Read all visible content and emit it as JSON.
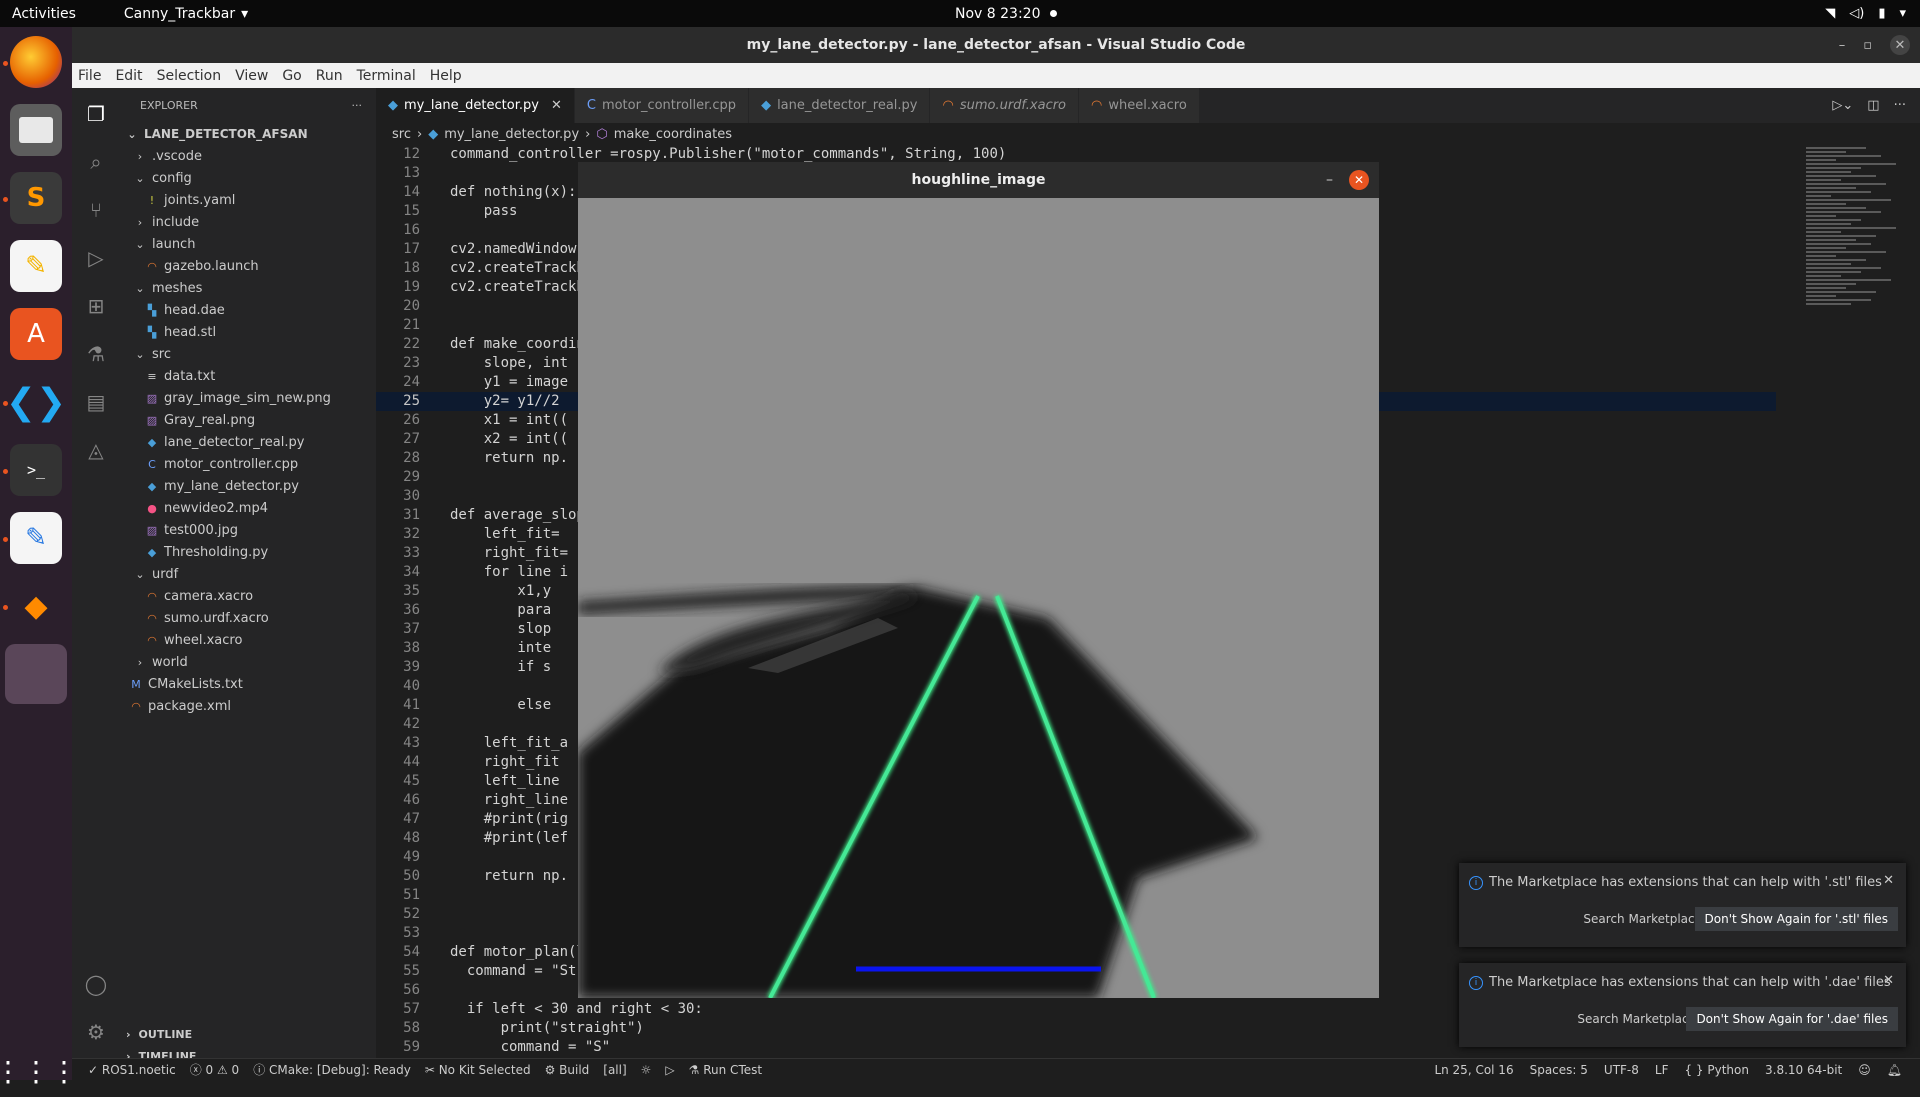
{
  "topbar": {
    "activities": "Activities",
    "app_name": "Canny_Trackbar",
    "clock": "Nov 8  23:20"
  },
  "window": {
    "title": "my_lane_detector.py - lane_detector_afsan - Visual Studio Code"
  },
  "menu": [
    "File",
    "Edit",
    "Selection",
    "View",
    "Go",
    "Run",
    "Terminal",
    "Help"
  ],
  "explorer": {
    "header": "EXPLORER",
    "root": "LANE_DETECTOR_AFSAN",
    "items": [
      {
        "label": ".vscode",
        "kind": "folder-closed",
        "depth": 1
      },
      {
        "label": "config",
        "kind": "folder-open",
        "depth": 1
      },
      {
        "label": "joints.yaml",
        "kind": "yaml",
        "depth": 2
      },
      {
        "label": "include",
        "kind": "folder-closed",
        "depth": 1
      },
      {
        "label": "launch",
        "kind": "folder-open",
        "depth": 1
      },
      {
        "label": "gazebo.launch",
        "kind": "xml",
        "depth": 2
      },
      {
        "label": "meshes",
        "kind": "folder-open",
        "depth": 1
      },
      {
        "label": "head.dae",
        "kind": "mesh",
        "depth": 2
      },
      {
        "label": "head.stl",
        "kind": "mesh",
        "depth": 2
      },
      {
        "label": "src",
        "kind": "folder-open",
        "depth": 1
      },
      {
        "label": "data.txt",
        "kind": "text",
        "depth": 2
      },
      {
        "label": "gray_image_sim_new.png",
        "kind": "image",
        "depth": 2
      },
      {
        "label": "Gray_real.png",
        "kind": "image",
        "depth": 2
      },
      {
        "label": "lane_detector_real.py",
        "kind": "python",
        "depth": 2
      },
      {
        "label": "motor_controller.cpp",
        "kind": "cpp",
        "depth": 2
      },
      {
        "label": "my_lane_detector.py",
        "kind": "python",
        "depth": 2
      },
      {
        "label": "newvideo2.mp4",
        "kind": "video",
        "depth": 2
      },
      {
        "label": "test000.jpg",
        "kind": "image",
        "depth": 2
      },
      {
        "label": "Thresholding.py",
        "kind": "python",
        "depth": 2
      },
      {
        "label": "urdf",
        "kind": "folder-open",
        "depth": 1
      },
      {
        "label": "camera.xacro",
        "kind": "xml",
        "depth": 2
      },
      {
        "label": "sumo.urdf.xacro",
        "kind": "xml",
        "depth": 2
      },
      {
        "label": "wheel.xacro",
        "kind": "xml",
        "depth": 2
      },
      {
        "label": "world",
        "kind": "folder-closed",
        "depth": 1
      },
      {
        "label": "CMakeLists.txt",
        "kind": "cmake",
        "depth": 0
      },
      {
        "label": "package.xml",
        "kind": "xml",
        "depth": 0
      }
    ],
    "outline": "OUTLINE",
    "timeline": "TIMELINE"
  },
  "tabs": [
    {
      "label": "my_lane_detector.py",
      "active": true
    },
    {
      "label": "motor_controller.cpp",
      "active": false
    },
    {
      "label": "lane_detector_real.py",
      "active": false
    },
    {
      "label": "sumo.urdf.xacro",
      "active": false
    },
    {
      "label": "wheel.xacro",
      "active": false
    }
  ],
  "breadcrumb": [
    "src",
    "my_lane_detector.py",
    "make_coordinates"
  ],
  "code": {
    "current_line": 25,
    "lines": [
      {
        "n": "12",
        "t": "command_controller =rospy.Publisher(\"motor_commands\", String, 100)"
      },
      {
        "n": "13",
        "t": ""
      },
      {
        "n": "14",
        "t": "def nothing(x):"
      },
      {
        "n": "15",
        "t": "    pass"
      },
      {
        "n": "16",
        "t": ""
      },
      {
        "n": "17",
        "t": "cv2.namedWindow("
      },
      {
        "n": "18",
        "t": "cv2.createTrackb"
      },
      {
        "n": "19",
        "t": "cv2.createTrackb"
      },
      {
        "n": "20",
        "t": ""
      },
      {
        "n": "21",
        "t": ""
      },
      {
        "n": "22",
        "t": "def make_coordin"
      },
      {
        "n": "23",
        "t": "    slope, int"
      },
      {
        "n": "24",
        "t": "    y1 = image"
      },
      {
        "n": "25",
        "t": "    y2= y1//2"
      },
      {
        "n": "26",
        "t": "    x1 = int(("
      },
      {
        "n": "27",
        "t": "    x2 = int(("
      },
      {
        "n": "28",
        "t": "    return np."
      },
      {
        "n": "29",
        "t": ""
      },
      {
        "n": "30",
        "t": ""
      },
      {
        "n": "31",
        "t": "def average_slop"
      },
      {
        "n": "32",
        "t": "    left_fit="
      },
      {
        "n": "33",
        "t": "    right_fit="
      },
      {
        "n": "34",
        "t": "    for line i"
      },
      {
        "n": "35",
        "t": "        x1,y"
      },
      {
        "n": "36",
        "t": "        para"
      },
      {
        "n": "37",
        "t": "        slop"
      },
      {
        "n": "38",
        "t": "        inte"
      },
      {
        "n": "39",
        "t": "        if s"
      },
      {
        "n": "40",
        "t": ""
      },
      {
        "n": "41",
        "t": "        else"
      },
      {
        "n": "42",
        "t": ""
      },
      {
        "n": "43",
        "t": "    left_fit_a"
      },
      {
        "n": "44",
        "t": "    right_fit"
      },
      {
        "n": "45",
        "t": "    left_line"
      },
      {
        "n": "46",
        "t": "    right_line"
      },
      {
        "n": "47",
        "t": "    #print(rig"
      },
      {
        "n": "48",
        "t": "    #print(lef"
      },
      {
        "n": "49",
        "t": ""
      },
      {
        "n": "50",
        "t": "    return np."
      },
      {
        "n": "51",
        "t": ""
      },
      {
        "n": "52",
        "t": ""
      },
      {
        "n": "53",
        "t": ""
      },
      {
        "n": "54",
        "t": "def motor_plan(l"
      },
      {
        "n": "55",
        "t": "  command = \"St"
      },
      {
        "n": "56",
        "t": ""
      },
      {
        "n": "57",
        "t": "  if left < 30 and right < 30:"
      },
      {
        "n": "58",
        "t": "      print(\"straight\")"
      },
      {
        "n": "59",
        "t": "      command = \"S\""
      }
    ]
  },
  "hough_window": {
    "title": "houghline_image"
  },
  "notifications": [
    {
      "message": "The Marketplace has extensions that can help with '.stl' files",
      "search": "Search Marketplace",
      "dont_show": "Don't Show Again for '.stl' files"
    },
    {
      "message": "The Marketplace has extensions that can help with '.dae' files",
      "search": "Search Marketplace",
      "dont_show": "Don't Show Again for '.dae' files"
    }
  ],
  "status": {
    "ros": "ROS1.noetic",
    "problems": "ⓧ 0 ⚠ 0",
    "cmake": "CMake: [Debug]: Ready",
    "kit": "No Kit Selected",
    "build": "Build",
    "all": "[all]",
    "ctest": "Run CTest",
    "position": "Ln 25, Col 16",
    "spaces": "Spaces: 5",
    "encoding": "UTF-8",
    "eol": "LF",
    "language": "Python",
    "interpreter": "3.8.10 64-bit"
  }
}
